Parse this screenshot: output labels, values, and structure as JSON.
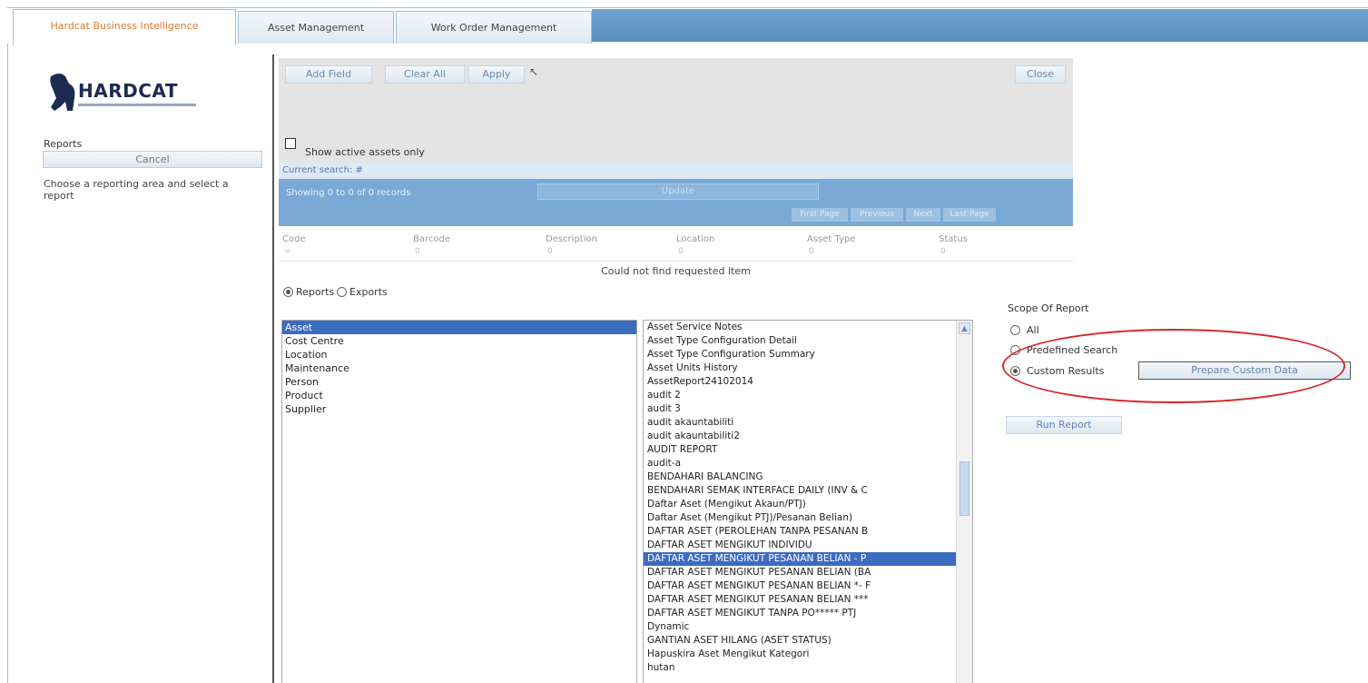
{
  "tabs": [
    {
      "label": "Hardcat Business Intelligence",
      "active": true
    },
    {
      "label": "Asset Management",
      "active": false
    },
    {
      "label": "Work Order Management",
      "active": false
    }
  ],
  "sidebar": {
    "logo_text": "HARDCAT",
    "reports_label": "Reports",
    "cancel_label": "Cancel",
    "instruction": "Choose a reporting area and select a report"
  },
  "toolbar": {
    "add_field": "Add Field",
    "clear_all": "Clear All",
    "apply": "Apply",
    "close": "Close"
  },
  "filter": {
    "active_only_label": "Show active assets only",
    "active_only_checked": false,
    "current_search": "Current search: #"
  },
  "results": {
    "showing": "Showing 0 to 0 of 0 records",
    "update_label": "Update",
    "pager": [
      "First Page",
      "Previous",
      "Next",
      "Last Page"
    ],
    "columns": [
      "Code",
      "Barcode",
      "Description",
      "Location",
      "Asset Type",
      "Status"
    ],
    "filters": [
      "=",
      "0",
      "0",
      "0",
      "0",
      "0"
    ],
    "empty_message": "Could not find requested item"
  },
  "mode": {
    "reports_label": "Reports",
    "exports_label": "Exports",
    "selected": "Reports"
  },
  "areas": [
    "Asset",
    "Cost Centre",
    "Location",
    "Maintenance",
    "Person",
    "Product",
    "Supplier"
  ],
  "selected_area": "Asset",
  "reports": [
    "Asset Service Notes",
    "Asset Type Configuration Detail",
    "Asset Type Configuration Summary",
    "Asset Units History",
    "AssetReport24102014",
    "audit 2",
    "audit 3",
    "audit akauntabiliti",
    "audit akauntabiliti2",
    "AUDIT REPORT",
    "audit-a",
    "BENDAHARI BALANCING",
    "BENDAHARI SEMAK INTERFACE DAILY (INV & C",
    "Daftar Aset (Mengikut Akaun/PTJ)",
    "Daftar Aset (Mengikut PTJ)/Pesanan Belian)",
    "DAFTAR ASET (PEROLEHAN TANPA PESANAN B",
    "DAFTAR ASET MENGIKUT INDIVIDU",
    "DAFTAR ASET MENGIKUT PESANAN BELIAN - P",
    "DAFTAR ASET MENGIKUT PESANAN BELIAN (BA",
    "DAFTAR ASET MENGIKUT PESANAN BELIAN *- F",
    "DAFTAR ASET MENGIKUT PESANAN BELIAN ***",
    "DAFTAR ASET MENGIKUT TANPA PO***** PTJ",
    "Dynamic",
    "GANTIAN ASET HILANG (ASET STATUS)",
    "Hapuskira Aset Mengikut Kategori",
    "hutan"
  ],
  "selected_report_index": 17,
  "scope": {
    "title": "Scope Of Report",
    "options": [
      "All",
      "Predefined Search",
      "Custom Results"
    ],
    "selected": "Custom Results",
    "prepare_label": "Prepare Custom Data",
    "run_label": "Run Report"
  },
  "colors": {
    "accent_tab": "#e07a2c",
    "selection": "#3c6cc0",
    "highlight_ellipse": "#d8232a"
  }
}
